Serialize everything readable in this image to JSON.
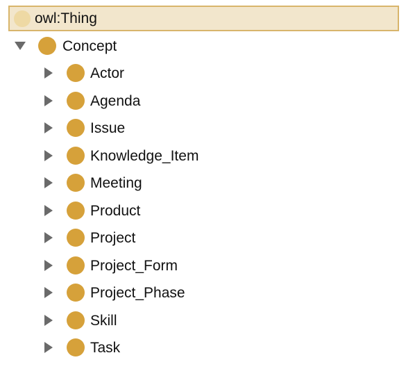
{
  "tree": {
    "root": {
      "label": "owl:Thing",
      "color": "#eed9a4"
    },
    "concept": {
      "label": "Concept",
      "expanded": true,
      "color": "#d6a13a"
    },
    "children": [
      {
        "label": "Actor"
      },
      {
        "label": "Agenda"
      },
      {
        "label": "Issue"
      },
      {
        "label": "Knowledge_Item"
      },
      {
        "label": "Meeting"
      },
      {
        "label": "Product"
      },
      {
        "label": "Project"
      },
      {
        "label": "Project_Form"
      },
      {
        "label": "Project_Phase"
      },
      {
        "label": "Skill"
      },
      {
        "label": "Task"
      }
    ],
    "selection_color": "#f2e6cc",
    "selection_border": "#d8b56b"
  }
}
